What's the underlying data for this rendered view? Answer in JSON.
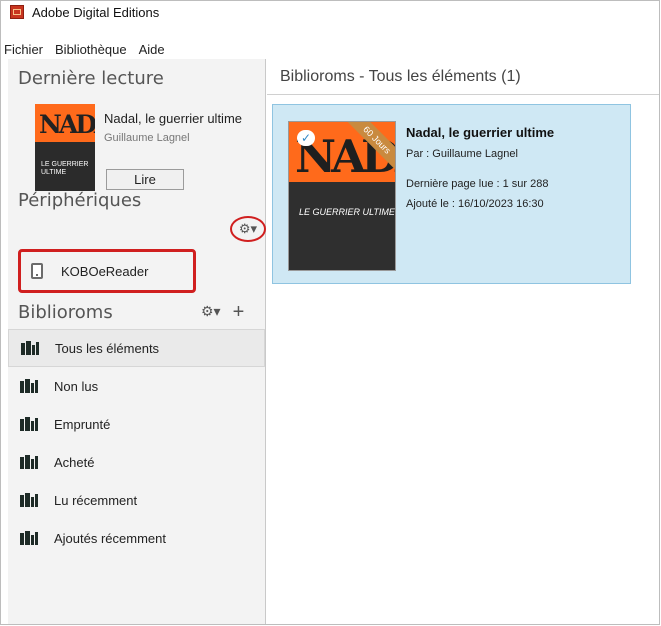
{
  "app": {
    "title": "Adobe Digital Editions"
  },
  "menu": {
    "items": [
      {
        "label": "Fichier"
      },
      {
        "label": "Bibliothèque"
      },
      {
        "label": "Aide"
      }
    ]
  },
  "sidebar": {
    "last_reading": {
      "title": "Dernière lecture",
      "book_title": "Nadal, le guerrier ultime",
      "book_author": "Guillaume Lagnel",
      "read_label": "Lire",
      "cover_title": "NADAL",
      "cover_subtitle": "LE GUERRIER ULTIME"
    },
    "devices": {
      "title": "Périphériques",
      "settings_glyph": "⚙▾",
      "items": [
        {
          "label": "KOBOeReader"
        }
      ]
    },
    "bibliorooms": {
      "title": "Biblioroms",
      "settings_glyph": "⚙▾",
      "add_glyph": "+",
      "items": [
        {
          "label": "Tous les éléments",
          "selected": true
        },
        {
          "label": "Non lus"
        },
        {
          "label": "Emprunté"
        },
        {
          "label": "Acheté"
        },
        {
          "label": "Lu récemment"
        },
        {
          "label": "Ajoutés récemment"
        }
      ]
    }
  },
  "main": {
    "header": "Biblioroms - Tous les éléments (1)",
    "book": {
      "title": "Nadal, le guerrier ultime",
      "author": "Par : Guillaume Lagnel",
      "last_page": "Dernière page lue : 1 sur 288",
      "added": "Ajouté le : 16/10/2023 16:30",
      "cover_title": "NADAL",
      "cover_subtitle": "LE GUERRIER ULTIME",
      "badge": "60 Jours"
    }
  },
  "colors": {
    "accent": "#d01f1f",
    "selection_bg": "#cfe8f4",
    "sidebar_bg": "#f3f3f3"
  },
  "icons": {
    "app": "adobe-digital-editions-icon",
    "settings": "gear-icon",
    "device": "ereader-icon",
    "collection": "books-icon",
    "sync": "cloud-check-icon"
  }
}
